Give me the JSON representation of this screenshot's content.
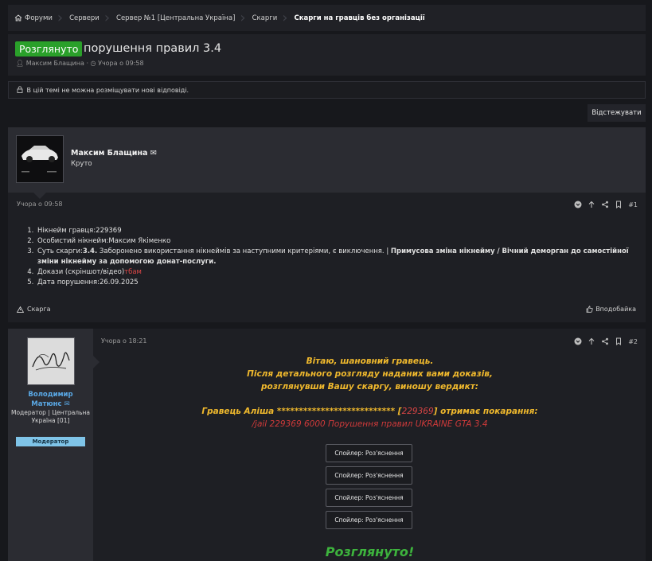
{
  "breadcrumb": {
    "items": [
      "Форуми",
      "Сервери",
      "Сервер №1 [Центральна Україна]",
      "Скарги",
      "Скарги на гравців без організації"
    ]
  },
  "thread": {
    "status_badge": "Розглянуто",
    "title": "порушення правил 3.4",
    "author": "Максим Блащина",
    "date": "Учора о 09:58"
  },
  "notice": "В цій темі не можна розміщувати нові відповіді.",
  "watch_button": "Відстежувати",
  "post1": {
    "author": "Максим Блащина",
    "user_title": "Круто",
    "date": "Учора о 09:58",
    "number": "#1",
    "items": {
      "nick": "Нікнейм гравця:229369",
      "own_nick": "Особистий нікнейм:Максим Якіменко",
      "essence_prefix": "Суть скарги:",
      "essence_rule": "3.4.",
      "essence_text": " Заборонено використання нікнеймів за наступними критеріями, є виключення. | ",
      "essence_bold": "Примусова зміна нікнейму / Вічний деморган до самостійної зміни нікнейму за допомогою донат-послуги.",
      "evidence_prefix": "Докази (скріншот/відео)",
      "evidence_link": "тбам",
      "violation_date": "Дата порушення:26.09.2025"
    },
    "report_label": "Скарга",
    "like_label": "Вподобайка"
  },
  "post2": {
    "author": "Володимир Матюнс",
    "user_title": "Модератор | Центральна Україна [01]",
    "role_badge": "Модератор",
    "date": "Учора о 18:21",
    "number": "#2",
    "greeting": "Вітаю, шановний гравець.",
    "line2": "Після детального розгляду наданих вами доказів,",
    "line3": "розглянувши Вашу скаргу, виношу вердикт:",
    "penalty_prefix": "Гравець Аліша *************************** [",
    "penalty_id": "229369",
    "penalty_suffix": "] отримає покарання:",
    "command": "/jail 229369 6000 Порушення правил UKRAINE GTA 3.4",
    "spoilers": [
      "Спойлер: Роз'яснення",
      "Спойлер: Роз'яснення",
      "Спойлер: Роз'яснення",
      "Спойлер: Роз'яснення"
    ],
    "reviewed": "Розглянуто!"
  },
  "colors": {
    "status_green": "#2aa02a",
    "moderator_blue": "#5aa9e6",
    "verdict_gold": "#f0b92d",
    "penalty_red": "#d03a3a",
    "reviewed_green": "#3db33d"
  }
}
